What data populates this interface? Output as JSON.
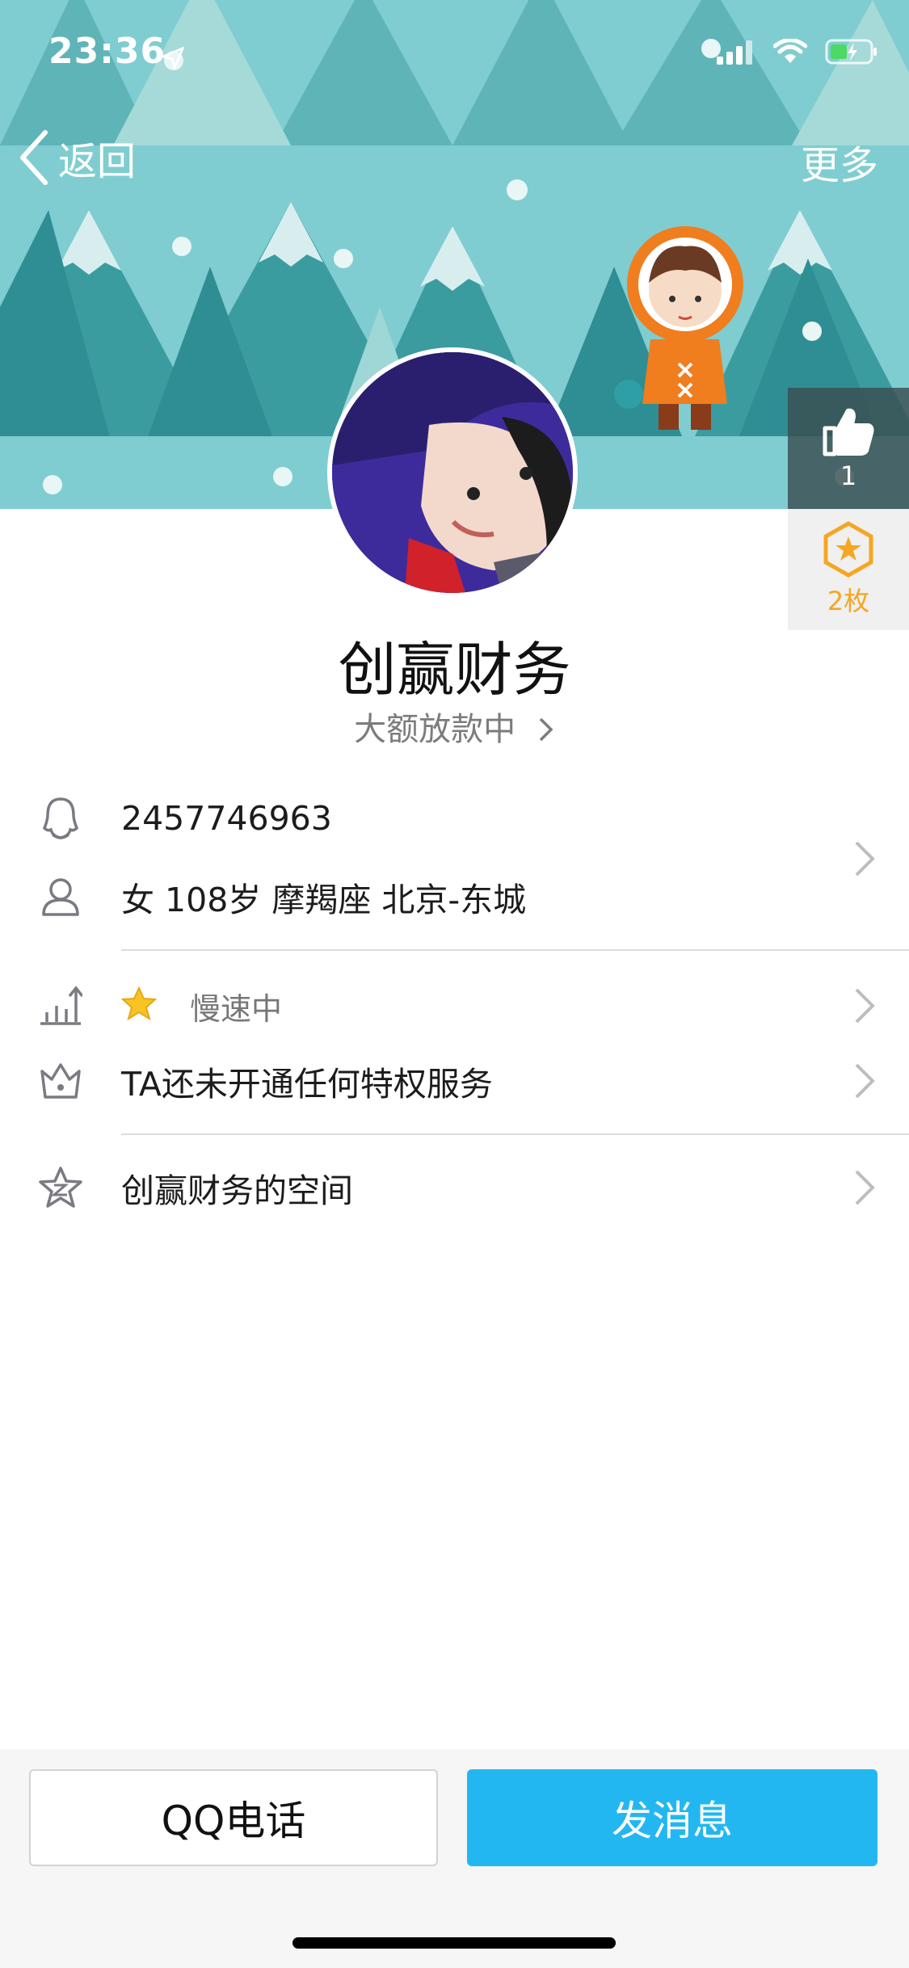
{
  "status": {
    "time": "23:36"
  },
  "nav": {
    "back_label": "返回",
    "more_label": "更多"
  },
  "side": {
    "like_count": "1",
    "medal_label": "2枚"
  },
  "profile": {
    "name": "创赢财务",
    "signature": "大额放款中",
    "qq_number": "2457746963",
    "details": "女 108岁 摩羯座 北京-东城",
    "level_status": "慢速中",
    "privilege": "TA还未开通任何特权服务",
    "space": "创赢财务的空间"
  },
  "actions": {
    "call_label": "QQ电话",
    "message_label": "发消息"
  },
  "colors": {
    "cover_bg": "#7fcdd1",
    "primary_button": "#23b7f2",
    "medal": "#f5a623"
  },
  "icons": {
    "back": "chevron-left-icon",
    "like": "thumbs-up-icon",
    "medal": "star-hexagon-icon",
    "qq": "penguin-icon",
    "person": "person-icon",
    "level": "bar-chart-icon",
    "star": "star-icon",
    "crown": "crown-icon",
    "space": "star-z-icon",
    "chevron": "chevron-right-icon"
  }
}
